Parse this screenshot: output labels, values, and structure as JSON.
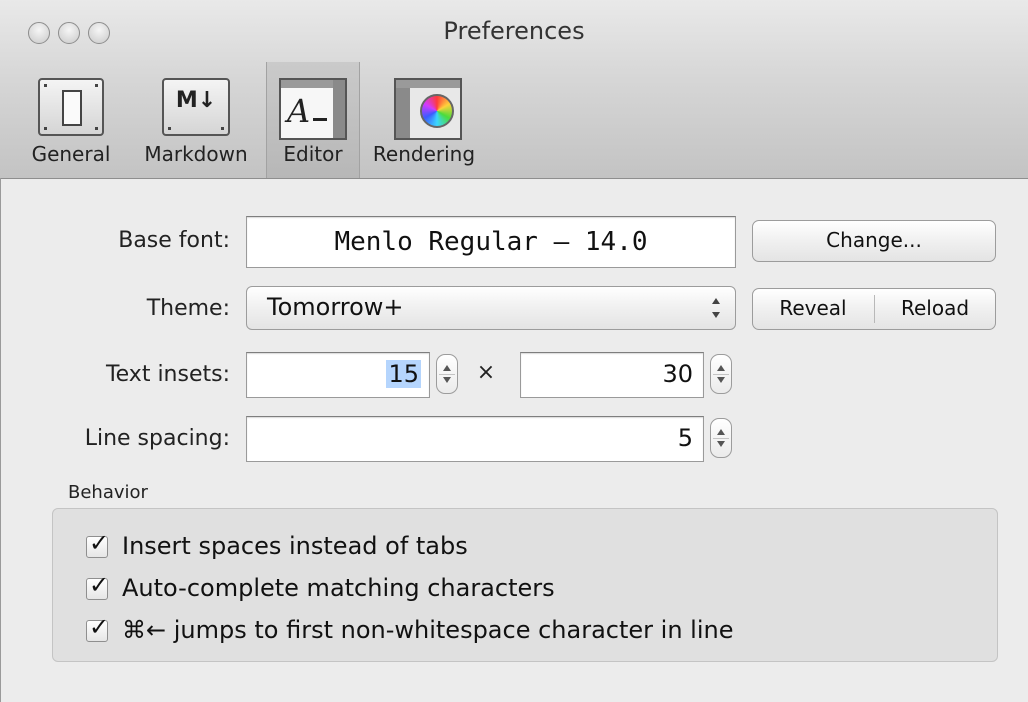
{
  "window": {
    "title": "Preferences"
  },
  "toolbar": {
    "items": [
      {
        "label": "General",
        "icon": "switch-icon",
        "selected": false
      },
      {
        "label": "Markdown",
        "icon": "markdown-icon",
        "selected": false
      },
      {
        "label": "Editor",
        "icon": "editor-icon",
        "selected": true
      },
      {
        "label": "Rendering",
        "icon": "color-wheel-icon",
        "selected": false
      }
    ]
  },
  "editor": {
    "base_font": {
      "label": "Base font:",
      "value": "Menlo Regular – 14.0",
      "button": "Change..."
    },
    "theme": {
      "label": "Theme:",
      "value": "Tomorrow+",
      "reveal": "Reveal",
      "reload": "Reload"
    },
    "text_insets": {
      "label": "Text insets:",
      "x_value": "15",
      "separator": "×",
      "y_value": "30"
    },
    "line_spacing": {
      "label": "Line spacing:",
      "value": "5"
    }
  },
  "behavior": {
    "title": "Behavior",
    "options": [
      {
        "label": "Insert spaces instead of tabs",
        "checked": true
      },
      {
        "label": "Auto-complete matching characters",
        "checked": true
      },
      {
        "label": "⌘← jumps to first non-whitespace character in line",
        "checked": true
      }
    ]
  }
}
